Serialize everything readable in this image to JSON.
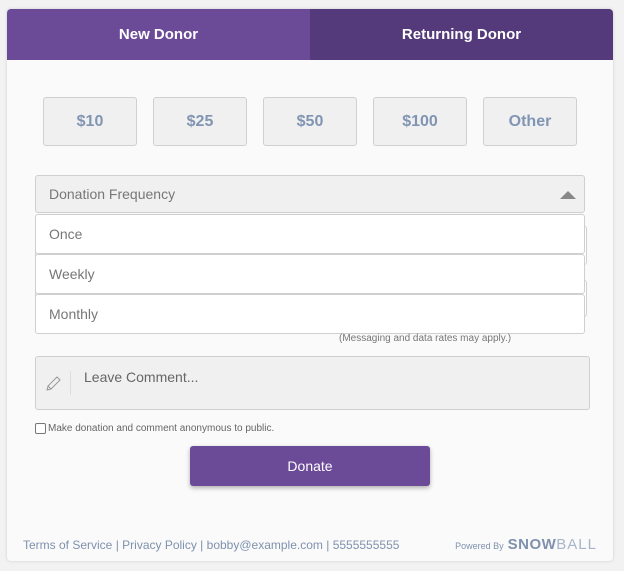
{
  "tabs": [
    {
      "label": "New Donor",
      "active": true
    },
    {
      "label": "Returning Donor",
      "active": false
    }
  ],
  "amounts": [
    "$10",
    "$25",
    "$50",
    "$100",
    "Other"
  ],
  "frequency": {
    "placeholder": "Donation Frequency",
    "options": [
      "Once",
      "Weekly",
      "Monthly"
    ],
    "icon": "triangle-up-icon"
  },
  "messaging_note": "(Messaging and data rates may apply.)",
  "comment": {
    "placeholder": "Leave Comment...",
    "icon": "pencil-icon"
  },
  "anonymous_label": "Make donation and comment anonymous to public.",
  "donate_label": "Donate",
  "footer": {
    "terms": "Terms of Service",
    "privacy": "Privacy Policy",
    "email": "bobby@example.com",
    "phone": "5555555555",
    "separator": " | ",
    "powered_by": "Powered By",
    "logo_bold": "SNOW",
    "logo_light": "BALL"
  },
  "colors": {
    "tab_active": "#6b4a98",
    "tab_inactive": "#543a7a",
    "button": "#6b4a98",
    "amount_text": "#8195b3"
  }
}
